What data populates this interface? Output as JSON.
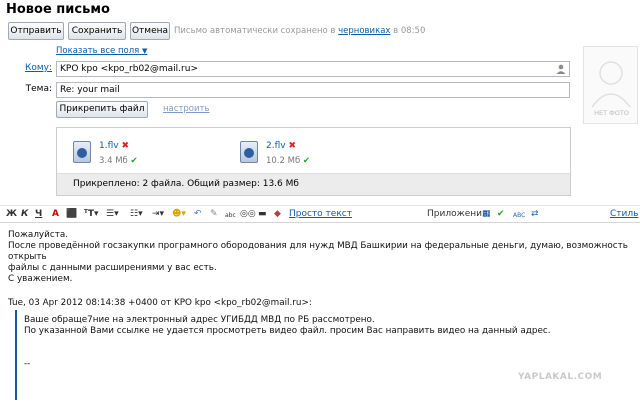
{
  "page": {
    "title": "Новое письмо"
  },
  "toolbar": {
    "send_label": "Отправить",
    "save_label": "Сохранить",
    "cancel_label": "Отмена",
    "saved_prefix": "Письмо автоматически сохранено в",
    "saved_link": "черновиках",
    "saved_suffix": "в 08:50"
  },
  "fields": {
    "show_all_label": "Показать все поля",
    "to_label": "Кому:",
    "to_value": "KPO kpo <kpo_rb02@mail.ru>",
    "subject_label": "Тема:",
    "subject_value": "Re: your mail"
  },
  "avatar": {
    "caption": "НЕТ ФОТО"
  },
  "attachments": {
    "attach_button": "Прикрепить файл",
    "configure_link": "настроить",
    "files": [
      {
        "name": "1.flv",
        "size": "3.4 Мб"
      },
      {
        "name": "2.flv",
        "size": "10.2 Мб"
      }
    ],
    "summary": "Прикреплено: 2 файла. Общий размер: 13.6 Мб"
  },
  "format": {
    "bold": "Ж",
    "italic": "К",
    "underline": "Ч",
    "plain_text_link": "Просто текст",
    "apps_label": "Приложения:",
    "styles_label": "Стиль"
  },
  "message": {
    "lines": [
      "Пожалуйста.",
      "После проведённой госзакупки програмного обородования для нужд МВД Башкирии на федеральные деньги, думаю, возможность открыть",
      "файлы с данными расширениями у вас есть.",
      "С уважением."
    ],
    "quote_header": "Tue, 03 Apr 2012 08:14:38 +0400 от KPO kpo <kpo_rb02@mail.ru>:",
    "quote_lines": [
      "Ваше обраще7ние на электронный адрес УГИБДД МВД по РБ рассмотрено.",
      "По указанной Вами ссылке не удается просмотреть видео файл. просим Вас направить видео на данный адрес."
    ],
    "signature": "--"
  },
  "watermark": "YAPLAKAL.COM"
}
